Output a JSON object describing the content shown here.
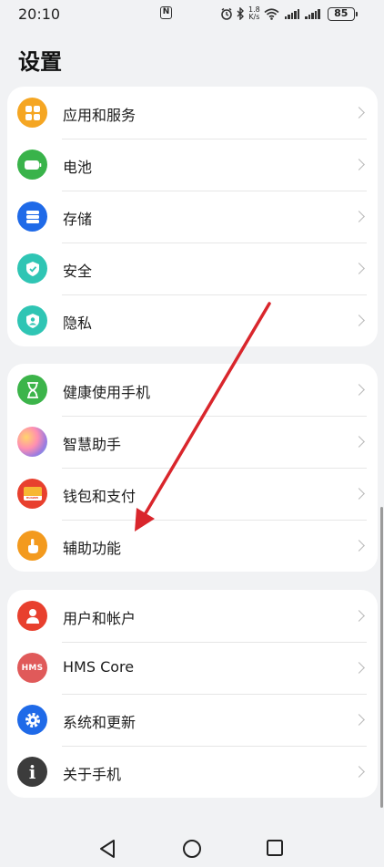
{
  "status_bar": {
    "time": "20:10",
    "net_speed_value": "1.8",
    "net_speed_unit": "K/s",
    "battery": "85"
  },
  "page": {
    "title": "设置"
  },
  "groups": [
    {
      "items": [
        {
          "label": "应用和服务",
          "icon": "apps-icon",
          "color": "#f5a623"
        },
        {
          "label": "电池",
          "icon": "battery-icon",
          "color": "#39b34a"
        },
        {
          "label": "存储",
          "icon": "storage-icon",
          "color": "#1f6ae8"
        },
        {
          "label": "安全",
          "icon": "shield-icon",
          "color": "#2fc5b4"
        },
        {
          "label": "隐私",
          "icon": "privacy-icon",
          "color": "#2fc5b4"
        }
      ]
    },
    {
      "items": [
        {
          "label": "健康使用手机",
          "icon": "hourglass-icon",
          "color": "#3cb44a"
        },
        {
          "label": "智慧助手",
          "icon": "assistant-icon",
          "color": "#9b7be0"
        },
        {
          "label": "钱包和支付",
          "icon": "wallet-icon",
          "color": "#e8402e",
          "sub_text": "HUAWEI"
        },
        {
          "label": "辅助功能",
          "icon": "hand-icon",
          "color": "#f39a1e"
        }
      ]
    },
    {
      "items": [
        {
          "label": "用户和帐户",
          "icon": "user-icon",
          "color": "#e8402e"
        },
        {
          "label": "HMS Core",
          "icon": "hms-icon",
          "color": "#e05a5a",
          "icon_text": "HMS"
        },
        {
          "label": "系统和更新",
          "icon": "gear-icon",
          "color": "#1f6ae8"
        },
        {
          "label": "关于手机",
          "icon": "info-icon",
          "color": "#3c3c3c",
          "icon_text": "i"
        }
      ]
    }
  ],
  "colors": {
    "annotation_arrow": "#d9262c",
    "background": "#f1f2f4"
  }
}
